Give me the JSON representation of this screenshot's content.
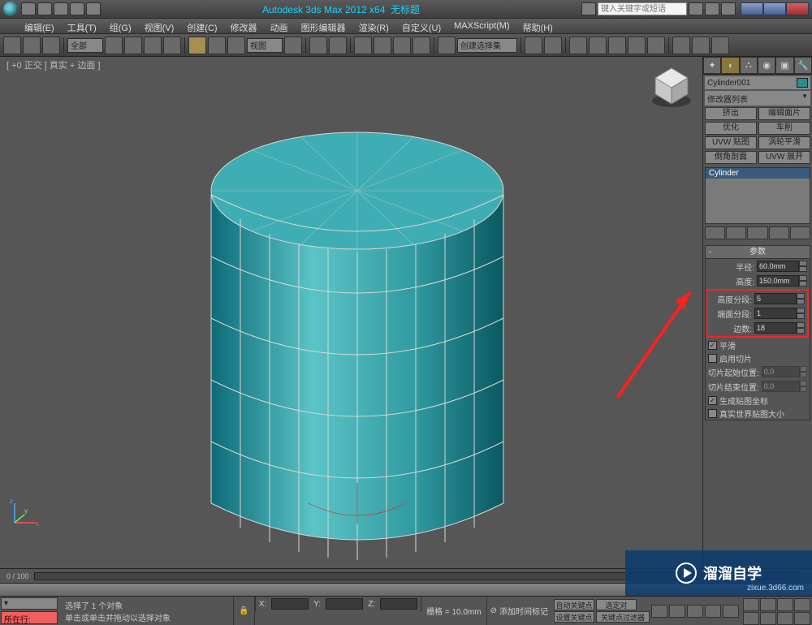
{
  "title": {
    "app": "Autodesk 3ds Max 2012 x64",
    "doc": "无标题"
  },
  "search_placeholder": "键入关键字或短语",
  "menu": [
    "编辑(E)",
    "工具(T)",
    "组(G)",
    "视图(V)",
    "创建(C)",
    "修改器",
    "动画",
    "图形编辑器",
    "渲染(R)",
    "自定义(U)",
    "MAXScript(M)",
    "帮助(H)"
  ],
  "toolbar": {
    "set_dropdown": "全部",
    "view_dropdown": "视图",
    "selset_dropdown": "创建选择集"
  },
  "viewport": {
    "label": "[ +0 正交 ] 真实 + 边面 ]"
  },
  "cmdpanel": {
    "object_name": "Cylinder001",
    "modifier_list": "修改器列表",
    "mod_buttons": [
      "挤出",
      "编辑面片",
      "优化",
      "车削",
      "UVW 贴图",
      "涡轮平滑",
      "倒角剖面",
      "UVW 展开"
    ],
    "stack_item": "Cylinder",
    "rollout_title": "参数",
    "params": {
      "radius_label": "半径:",
      "radius": "60.0mm",
      "height_label": "高度:",
      "height": "150.0mm",
      "hseg_label": "高度分段:",
      "hseg": "5",
      "cseg_label": "端面分段:",
      "cseg": "1",
      "sides_label": "边数:",
      "sides": "18",
      "smooth": "平滑",
      "slice_on": "启用切片",
      "slice_from_label": "切片起始位置:",
      "slice_from": "0.0",
      "slice_to_label": "切片结束位置:",
      "slice_to": "0.0",
      "genuv": "生成贴图坐标",
      "realworld": "真实世界贴图大小"
    }
  },
  "timeline": {
    "range": "0 / 100"
  },
  "status": {
    "locked_label": "所在行:",
    "line1": "选择了 1 个对象",
    "line2": "单击或单击并拖动以选择对象",
    "addtime": "添加时间标记",
    "x": "X:",
    "y": "Y:",
    "z": "Z:",
    "grid": "栅格 = 10.0mm",
    "autokey": "自动关键点",
    "selset": "选定对",
    "setkey": "设置关键点",
    "keyfilter": "关键点过滤器"
  },
  "watermark": {
    "text": "溜溜自学",
    "url": "zixue.3d66.com"
  }
}
